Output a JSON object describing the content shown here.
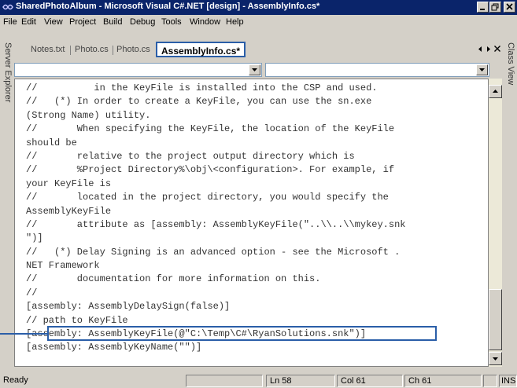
{
  "window": {
    "title": "SharedPhotoAlbum - Microsoft Visual C#.NET [design] - AssemblyInfo.cs*"
  },
  "menu": [
    "File",
    "Edit",
    "View",
    "Project",
    "Build",
    "Debug",
    "Tools",
    "Window",
    "Help"
  ],
  "left_panel_label": "Server Explorer",
  "right_panel_label": "Class View",
  "tabs": [
    "Notes.txt",
    "Photo.cs",
    "Photo.cs",
    "AssemblyInfo.cs*"
  ],
  "active_tab_index": 3,
  "code_lines": [
    "//          in the KeyFile is installed into the CSP and used.",
    "//   (*) In order to create a KeyFile, you can use the sn.exe",
    "(Strong Name) utility.",
    "//       When specifying the KeyFile, the location of the KeyFile",
    "should be",
    "//       relative to the project output directory which is",
    "//       %Project Directory%\\obj\\<configuration>. For example, if",
    "your KeyFile is",
    "//       located in the project directory, you would specify the",
    "AssemblyKeyFile",
    "//       attribute as [assembly: AssemblyKeyFile(\"..\\\\..\\\\mykey.snk",
    "\")]",
    "//   (*) Delay Signing is an advanced option - see the Microsoft .",
    "NET Framework",
    "//       documentation for more information on this.",
    "//",
    "[assembly: AssemblyDelaySign(false)]",
    "// path to KeyFile",
    "[assembly: AssemblyKeyFile(@\"C:\\Temp\\C#\\RyanSolutions.snk\")]",
    "[assembly: AssemblyKeyName(\"\")]"
  ],
  "status": {
    "text": "Ready",
    "line": "Ln 58",
    "col": "Col 61",
    "ch": "Ch 61",
    "mode": "INS"
  },
  "colors": {
    "titlebar": "#0a246a",
    "highlight": "#2a5ea8"
  }
}
